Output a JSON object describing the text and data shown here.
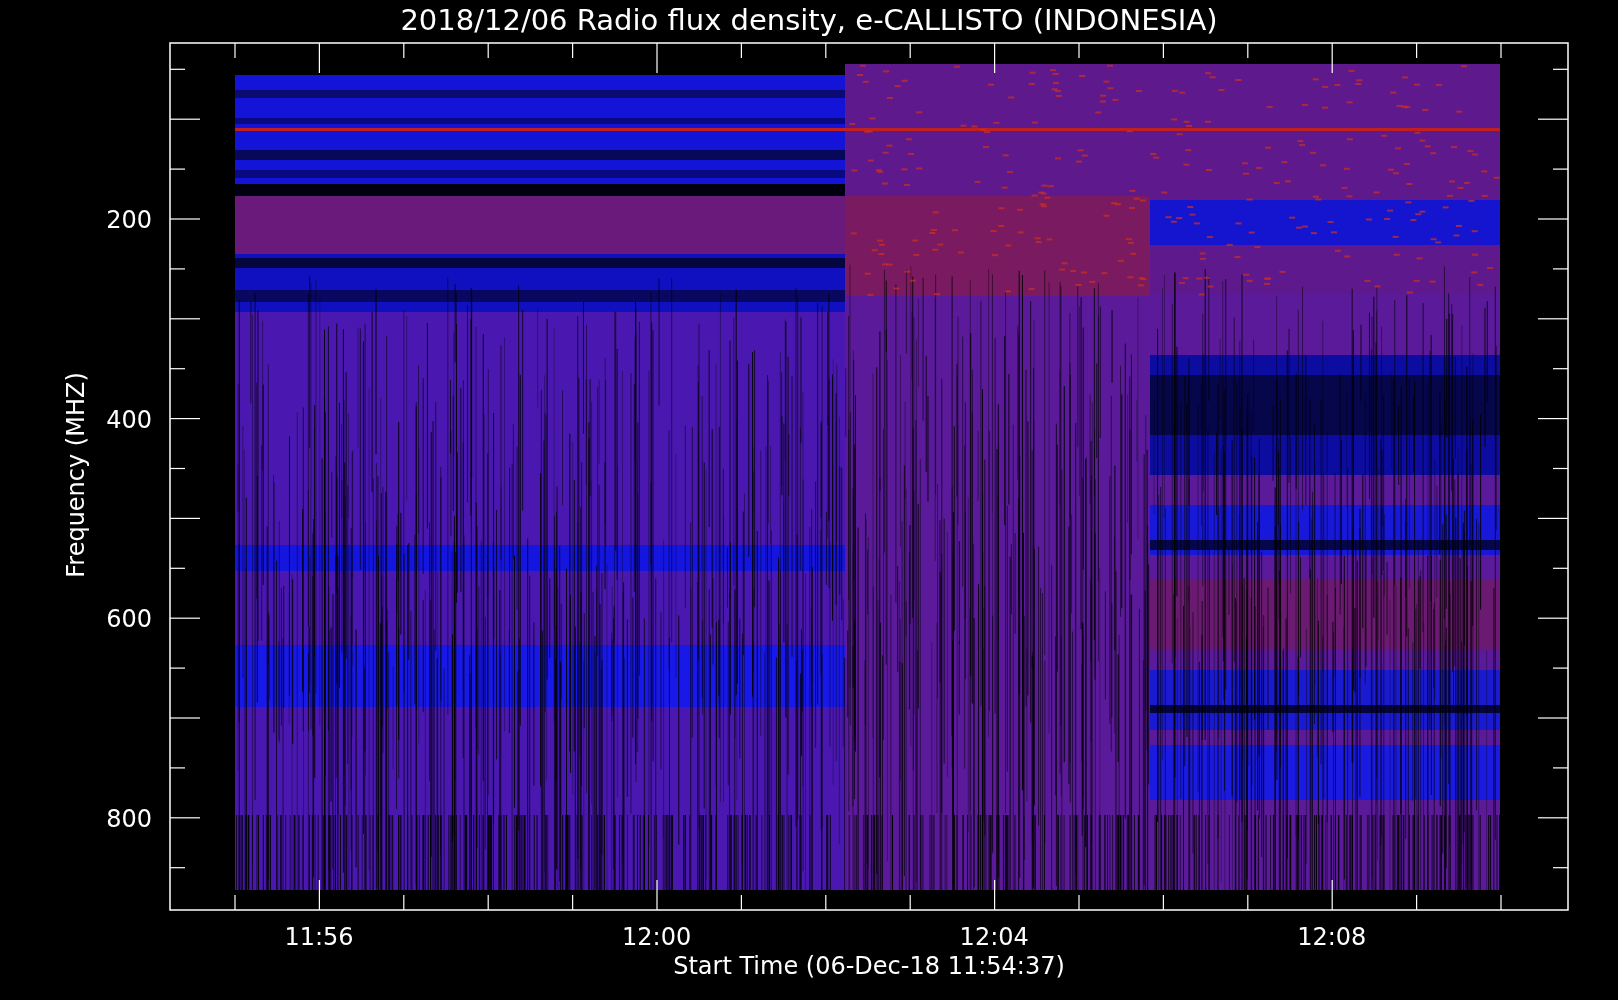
{
  "plot": {
    "title": "2018/12/06  Radio flux density, e-CALLISTO (INDONESIA)",
    "xlabel": "Start Time (06-Dec-18 11:54:37)",
    "ylabel": "Frequency (MHZ)",
    "xtick_labels": [
      "11:56",
      "12:00",
      "12:04",
      "12:08"
    ],
    "ytick_labels": [
      "200",
      "400",
      "600",
      "800"
    ]
  }
}
